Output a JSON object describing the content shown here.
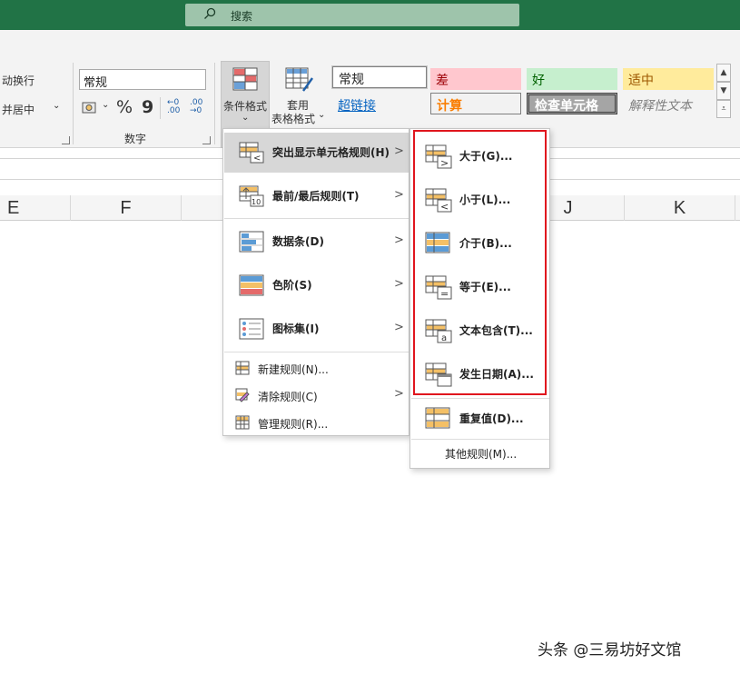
{
  "titlebar": {
    "search_label": "搜索",
    "color": "#217346"
  },
  "ribbon": {
    "wrap_text": "动换行",
    "merge_center": "并居中",
    "number_format_value": "常规",
    "percent_symbol": "%",
    "comma_symbol": "9",
    "increase_decimal": "←0 .00",
    "decrease_decimal": ".00 →0",
    "number_group_label": "数字",
    "conditional_format": "条件格式",
    "table_format_line1": "套用",
    "table_format_line2": "表格格式"
  },
  "cell_styles": {
    "normal": "常规",
    "bad": "差",
    "good": "好",
    "neutral": "适中",
    "hyperlink": "超链接",
    "calculation": "计算",
    "check_cell": "检查单元格",
    "explanatory": "解释性文本",
    "colors": {
      "bad_bg": "#ffc7ce",
      "bad_fg": "#9c0006",
      "good_bg": "#c6efce",
      "good_fg": "#006100",
      "neutral_bg": "#ffeb9c",
      "neutral_fg": "#9c5700",
      "calc_fg": "#fa7d00",
      "check_bg": "#a5a5a5"
    }
  },
  "columns": {
    "E": "E",
    "F": "F",
    "J": "J",
    "K": "K"
  },
  "menu": {
    "highlight_rules": "突出显示单元格规则(H)",
    "top_bottom_rules": "最前/最后规则(T)",
    "data_bars": "数据条(D)",
    "color_scales": "色阶(S)",
    "icon_sets": "图标集(I)",
    "new_rule": "新建规则(N)...",
    "clear_rules": "清除规则(C)",
    "manage_rules": "管理规则(R)..."
  },
  "submenu": {
    "greater_than": "大于(G)...",
    "less_than": "小于(L)...",
    "between": "介于(B)...",
    "equal_to": "等于(E)...",
    "text_contains": "文本包含(T)...",
    "date_occurring": "发生日期(A)...",
    "duplicate_values": "重复值(D)...",
    "more_rules": "其他规则(M)...",
    "highlight_color": "#e0161e"
  },
  "watermark": "头条 @三易坊好文馆"
}
